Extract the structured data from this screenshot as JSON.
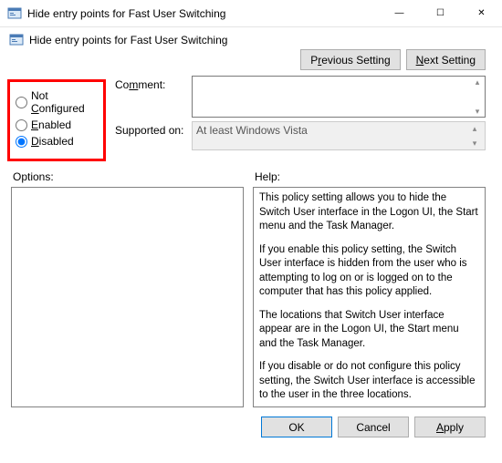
{
  "window": {
    "title": "Hide entry points for Fast User Switching",
    "minimize": "—",
    "maximize": "☐",
    "close": "✕"
  },
  "header": {
    "title": "Hide entry points for Fast User Switching"
  },
  "nav": {
    "previous_pre": "P",
    "previous_ul": "r",
    "previous_post": "evious Setting",
    "next_ul": "N",
    "next_post": "ext Setting"
  },
  "radios": {
    "not_configured_pre": "Not ",
    "not_configured_ul": "C",
    "not_configured_post": "onfigured",
    "enabled_ul": "E",
    "enabled_post": "nabled",
    "disabled_ul": "D",
    "disabled_post": "isabled",
    "selected": "disabled"
  },
  "comment": {
    "label_pre": "Co",
    "label_ul": "m",
    "label_post": "ment:",
    "value": ""
  },
  "supported": {
    "label": "Supported on:",
    "value": "At least Windows Vista"
  },
  "options": {
    "label": "Options:"
  },
  "help": {
    "label": "Help:",
    "p1": "This policy setting allows you to hide the Switch User interface in the Logon UI, the Start menu and the Task Manager.",
    "p2": "If you enable this policy setting, the Switch User interface is hidden from the user who is attempting to log on or is logged on to the computer that has this policy applied.",
    "p3": "The locations that Switch User interface appear are in the Logon UI, the Start menu and the Task Manager.",
    "p4": "If you disable or do not configure this policy setting, the Switch User interface is accessible to the user in the three locations."
  },
  "footer": {
    "ok": "OK",
    "cancel": "Cancel",
    "apply_ul": "A",
    "apply_post": "pply"
  }
}
